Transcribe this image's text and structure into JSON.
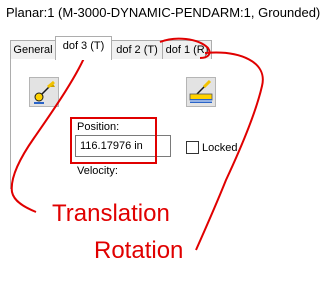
{
  "window": {
    "title": "Planar:1 (M-3000-DYNAMIC-PENDARM:1, Grounded)"
  },
  "tabs": [
    {
      "label": "General",
      "active": false
    },
    {
      "label": "dof 3 (T)",
      "active": true
    },
    {
      "label": "dof 2 (T)",
      "active": false
    },
    {
      "label": "dof 1 (R)",
      "active": false
    }
  ],
  "panel": {
    "translation_icon": "translation-dof-icon",
    "rotation_icon": "rotation-dof-icon",
    "position_label": "Position:",
    "position_value": "116.17976 in",
    "locked_label": "Locked",
    "locked_checked": false,
    "velocity_label": "Velocity:"
  },
  "annotations": {
    "translation": "Translation",
    "rotation": "Rotation",
    "color": "#e00000"
  }
}
